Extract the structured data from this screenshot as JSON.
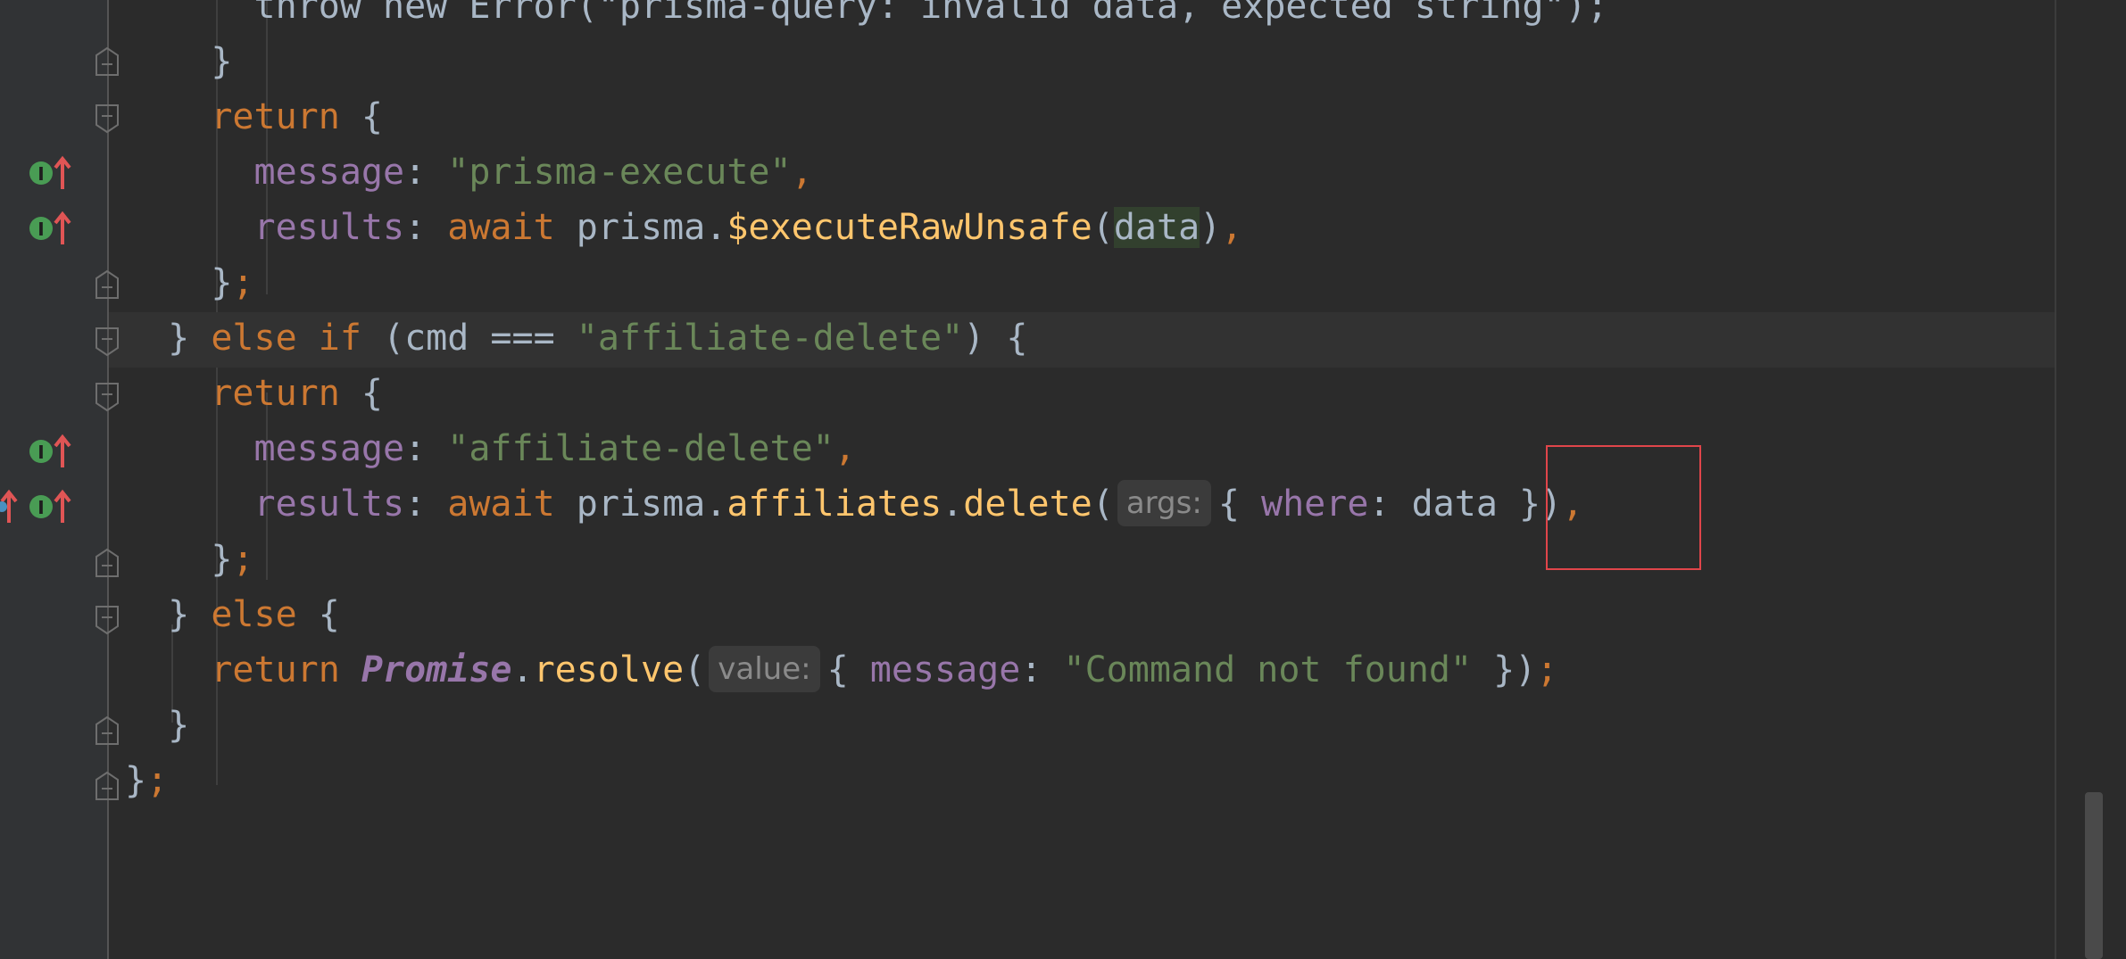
{
  "editor": {
    "lines": [
      {
        "id": "l0",
        "tokens": [
          {
            "t": "      throw new Error(\"prisma-query: invalid data, expected string\");",
            "c": ""
          }
        ]
      },
      {
        "id": "l1",
        "tokens": [
          {
            "t": "    }",
            "c": ""
          }
        ]
      },
      {
        "id": "l2",
        "tokens": [
          {
            "t": "    return",
            "c": "kw"
          },
          {
            "t": " {",
            "c": ""
          }
        ]
      },
      {
        "id": "l3",
        "tokens": [
          {
            "t": "      ",
            "c": ""
          },
          {
            "t": "message",
            "c": "prop"
          },
          {
            "t": ": ",
            "c": ""
          },
          {
            "t": "\"prisma-execute\"",
            "c": "str"
          },
          {
            "t": ",",
            "c": "punc"
          }
        ]
      },
      {
        "id": "l4",
        "tokens": [
          {
            "t": "      ",
            "c": ""
          },
          {
            "t": "results",
            "c": "prop"
          },
          {
            "t": ": ",
            "c": ""
          },
          {
            "t": "await",
            "c": "kw"
          },
          {
            "t": " prisma.",
            "c": ""
          },
          {
            "t": "$executeRawUnsafe",
            "c": "fn"
          },
          {
            "t": "(",
            "c": ""
          },
          {
            "t": "data",
            "c": "hl"
          },
          {
            "t": ")",
            "c": ""
          },
          {
            "t": ",",
            "c": "punc"
          }
        ]
      },
      {
        "id": "l5",
        "tokens": [
          {
            "t": "    }",
            "c": ""
          },
          {
            "t": ";",
            "c": "punc"
          }
        ]
      },
      {
        "id": "l6",
        "tokens": [
          {
            "t": "  } ",
            "c": ""
          },
          {
            "t": "else if",
            "c": "kw"
          },
          {
            "t": " (cmd === ",
            "c": ""
          },
          {
            "t": "\"affiliate-delete\"",
            "c": "str"
          },
          {
            "t": ") {",
            "c": ""
          }
        ]
      },
      {
        "id": "l7",
        "tokens": [
          {
            "t": "    ",
            "c": ""
          },
          {
            "t": "return",
            "c": "kw"
          },
          {
            "t": " {",
            "c": ""
          }
        ]
      },
      {
        "id": "l8",
        "tokens": [
          {
            "t": "      ",
            "c": ""
          },
          {
            "t": "message",
            "c": "prop"
          },
          {
            "t": ": ",
            "c": ""
          },
          {
            "t": "\"affiliate-delete\"",
            "c": "str"
          },
          {
            "t": ",",
            "c": "punc"
          }
        ]
      },
      {
        "id": "l9",
        "tokens": [
          {
            "t": "      ",
            "c": ""
          },
          {
            "t": "results",
            "c": "prop"
          },
          {
            "t": ": ",
            "c": ""
          },
          {
            "t": "await",
            "c": "kw"
          },
          {
            "t": " prisma.",
            "c": ""
          },
          {
            "t": "affiliates",
            "c": "fn"
          },
          {
            "t": ".",
            "c": ""
          },
          {
            "t": "delete",
            "c": "fn"
          },
          {
            "t": "(",
            "c": ""
          },
          {
            "t": "args:",
            "c": "hint"
          },
          {
            "t": "{ ",
            "c": ""
          },
          {
            "t": "where",
            "c": "prop"
          },
          {
            "t": ": data }",
            "c": ""
          },
          {
            "t": ")",
            "c": ""
          },
          {
            "t": ",",
            "c": "punc"
          }
        ]
      },
      {
        "id": "l10",
        "tokens": [
          {
            "t": "    }",
            "c": ""
          },
          {
            "t": ";",
            "c": "punc"
          }
        ]
      },
      {
        "id": "l11",
        "tokens": [
          {
            "t": "  } ",
            "c": ""
          },
          {
            "t": "else",
            "c": "kw"
          },
          {
            "t": " {",
            "c": ""
          }
        ]
      },
      {
        "id": "l12",
        "tokens": [
          {
            "t": "    ",
            "c": ""
          },
          {
            "t": "return",
            "c": "kw"
          },
          {
            "t": " ",
            "c": ""
          },
          {
            "t": "Promise",
            "c": "cls"
          },
          {
            "t": ".",
            "c": ""
          },
          {
            "t": "resolve",
            "c": "fn"
          },
          {
            "t": "(",
            "c": ""
          },
          {
            "t": "value:",
            "c": "hint"
          },
          {
            "t": "{ ",
            "c": ""
          },
          {
            "t": "message",
            "c": "prop"
          },
          {
            "t": ": ",
            "c": ""
          },
          {
            "t": "\"Command not found\"",
            "c": "str"
          },
          {
            "t": " })",
            "c": ""
          },
          {
            "t": ";",
            "c": "punc"
          }
        ]
      },
      {
        "id": "l13",
        "tokens": [
          {
            "t": "  }",
            "c": ""
          }
        ]
      },
      {
        "id": "l14",
        "tokens": [
          {
            "t": "}",
            "c": ""
          },
          {
            "t": ";",
            "c": "punc"
          }
        ]
      }
    ]
  },
  "gutter": {
    "icon": "implementation-up-arrow-icon",
    "fold_icon": "fold-marker-icon",
    "colors": {
      "impl_green": "#499c54",
      "arrow_red": "#e05555",
      "fold": "#6e6e6e"
    }
  },
  "highlight": {
    "color": "#e0454a"
  }
}
